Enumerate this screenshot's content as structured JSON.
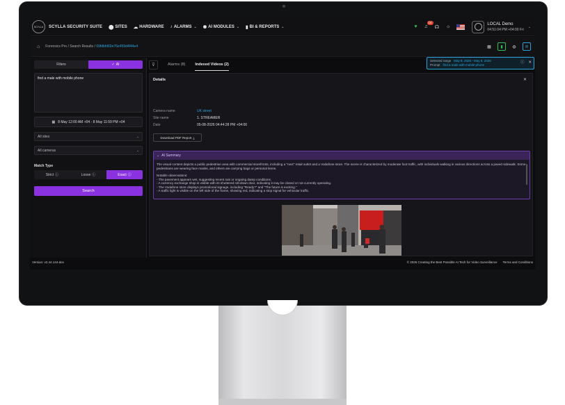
{
  "nav": {
    "brand": "SCYLLA SECURITY SUITE",
    "logo_text": "SCYLLA",
    "items": [
      {
        "label": "SITES",
        "icon": "pin-icon"
      },
      {
        "label": "HARDWARE",
        "icon": "cloud-icon"
      },
      {
        "label": "ALARMS",
        "icon": "bell-icon"
      },
      {
        "label": "AI MODULES",
        "icon": "brain-icon"
      },
      {
        "label": "BI & REPORTS",
        "icon": "bar-chart-icon"
      }
    ],
    "notif_count": "14",
    "user": {
      "name": "LOCAL Demo",
      "time": "04:51:04 PM +04:00 Fri"
    }
  },
  "breadcrumb": {
    "items": [
      "Forensics Pro",
      "Search Results"
    ],
    "separator": "/",
    "current_hash": "69fdbfd60e76e459d4f44e4"
  },
  "left": {
    "tabs": {
      "filters": "Filters",
      "ai": "AI"
    },
    "prompt_text": "find a male with mobile phone",
    "date_range": "8 May 12:00 AM +04 - 8 May 11:59 PM +04",
    "sites_select": "All sites",
    "cameras_select": "All cameras",
    "match_type_label": "Match Type",
    "match_options": [
      "Strict",
      "Loose",
      "Exact"
    ],
    "search_button": "Search"
  },
  "tabs": {
    "alarms": "Alarms (8)",
    "indexed": "Indexed Videos (2)"
  },
  "infobox": {
    "selected_range_label": "Selected range",
    "selected_range_value": "May 8, 2026 - May 8, 2026",
    "prompt_label": "Prompt",
    "prompt_value": "find a male with mobile phone"
  },
  "details": {
    "title": "Details",
    "camera_name_label": "Camera name",
    "camera_name": "UK street",
    "site_name_label": "Site name",
    "site_name": "1. STREAMER",
    "date_label": "Date",
    "date": "05-08-2026 04:44:28 PM +04:00",
    "pdf_button": "Download PDF Report",
    "ai_summary_title": "AI Summary",
    "ai_summary": [
      "The visual content depicts a public pedestrian area with commercial storefronts, including a \"next\" retail outlet and a Vodafone store. The scene is characterized by moderate foot traffic, with individuals walking in various directions across a paved sidewalk. Some pedestrians are wearing face masks, and others are carrying bags or personal items.",
      "",
      "Notable observations:",
      "- The pavement appears wet, suggesting recent rain or ongoing damp conditions.",
      "- A currency exchange shop is visible with its shuttered roll-down door, indicating it may be closed or not currently operating.",
      "- The Vodafone store displays promotional signage, including \"Ready?\" and \"The future is exciting.\"",
      "- A traffic light is visible on the left side of the frame, showing red, indicating a stop signal for vehicular traffic."
    ]
  },
  "footer": {
    "version": "Version: v2.44.144-dev",
    "copyright": "© 2026 Creating the Best Possible AI Tech for Video Surveillance",
    "terms": "Terms and Conditions"
  },
  "colors": {
    "accent": "#8a32e0",
    "link": "#2aa3d8",
    "background": "#0c0c0e"
  }
}
